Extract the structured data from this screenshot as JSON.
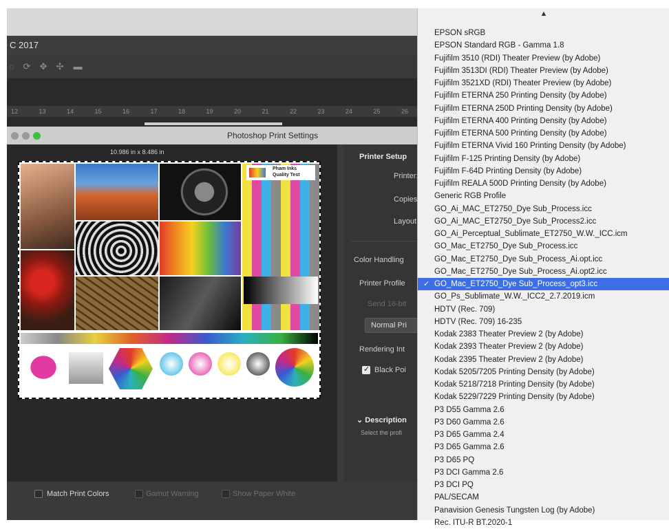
{
  "app": {
    "title": "C 2017",
    "ruler_ticks": [
      "12",
      "13",
      "14",
      "15",
      "16",
      "17",
      "18",
      "19",
      "20",
      "21",
      "22",
      "23",
      "24",
      "25",
      "26"
    ]
  },
  "dialog": {
    "title": "Photoshop Print Settings",
    "paper_size": "10.986 in x 8.486 in",
    "preview_text": {
      "logo_line1": "Pham Inks",
      "logo_line2": "Quality Test"
    },
    "printer_setup": {
      "heading": "Printer Setup",
      "printer_label": "Printer:",
      "copies_label": "Copies:",
      "layout_label": "Layout:"
    },
    "color_handling": {
      "heading": "Color Handling",
      "printer_profile_label": "Printer Profile",
      "send_16bit": "Send 16-bit",
      "normal_printing": "Normal Pri",
      "rendering_intent_label": "Rendering Int",
      "black_point": "Black Poi"
    },
    "description": {
      "heading": "Description",
      "text": "Select the profi"
    },
    "bottom": {
      "match_print_colors": "Match Print Colors",
      "gamut_warning": "Gamut Warning",
      "show_paper_white": "Show Paper White"
    }
  },
  "menu": {
    "scroll_arrow": "▲",
    "checkmark": "✓",
    "items": [
      "EPSON  sRGB",
      "EPSON  Standard RGB - Gamma 1.8",
      "Fujifilm 3510 (RDI) Theater Preview (by Adobe)",
      "Fujifilm 3513DI (RDI) Theater Preview (by Adobe)",
      "Fujifilm 3521XD (RDI) Theater Preview (by Adobe)",
      "Fujifilm ETERNA 250 Printing Density (by Adobe)",
      "Fujifilm ETERNA 250D Printing Density (by Adobe)",
      "Fujifilm ETERNA 400 Printing Density (by Adobe)",
      "Fujifilm ETERNA 500 Printing Density (by Adobe)",
      "Fujifilm ETERNA Vivid 160 Printing Density (by Adobe)",
      "Fujifilm F-125 Printing Density (by Adobe)",
      "Fujifilm F-64D Printing Density (by Adobe)",
      "Fujifilm REALA 500D Printing Density (by Adobe)",
      "Generic RGB Profile",
      "GO_Ai_MAC_ET2750_Dye Sub_Process.icc",
      "GO_Ai_MAC_ET2750_Dye Sub_Process2.icc",
      "GO_Ai_Perceptual_Sublimate_ET2750_W.W._ICC.icm",
      "GO_Mac_ET2750_Dye Sub_Process.icc",
      "GO_Mac_ET2750_Dye Sub_Process_Ai.opt.icc",
      "GO_Mac_ET2750_Dye Sub_Process_Ai.opt2.icc",
      "GO_Mac_ET2750_Dye Sub_Process_opt3.icc",
      "GO_Ps_Sublimate_W.W._ICC2_2.7.2019.icm",
      "HDTV (Rec. 709)",
      "HDTV (Rec. 709) 16-235",
      "Kodak 2383 Theater Preview 2 (by Adobe)",
      "Kodak 2393 Theater Preview 2 (by Adobe)",
      "Kodak 2395 Theater Preview 2 (by Adobe)",
      "Kodak 5205/7205 Printing Density (by Adobe)",
      "Kodak 5218/7218 Printing Density (by Adobe)",
      "Kodak 5229/7229 Printing Density (by Adobe)",
      "P3 D55 Gamma 2.6",
      "P3 D60 Gamma 2.6",
      "P3 D65 Gamma 2.4",
      "P3 D65 Gamma 2.6",
      "P3 D65 PQ",
      "P3 DCI Gamma 2.6",
      "P3 DCI PQ",
      "PAL/SECAM",
      "Panavision Genesis Tungsten Log (by Adobe)",
      "Rec. ITU-R BT.2020-1"
    ],
    "selected_index": 20
  },
  "colors": {
    "menu_highlight": "#3d6ee5",
    "traffic_green": "#3fbf3f"
  }
}
